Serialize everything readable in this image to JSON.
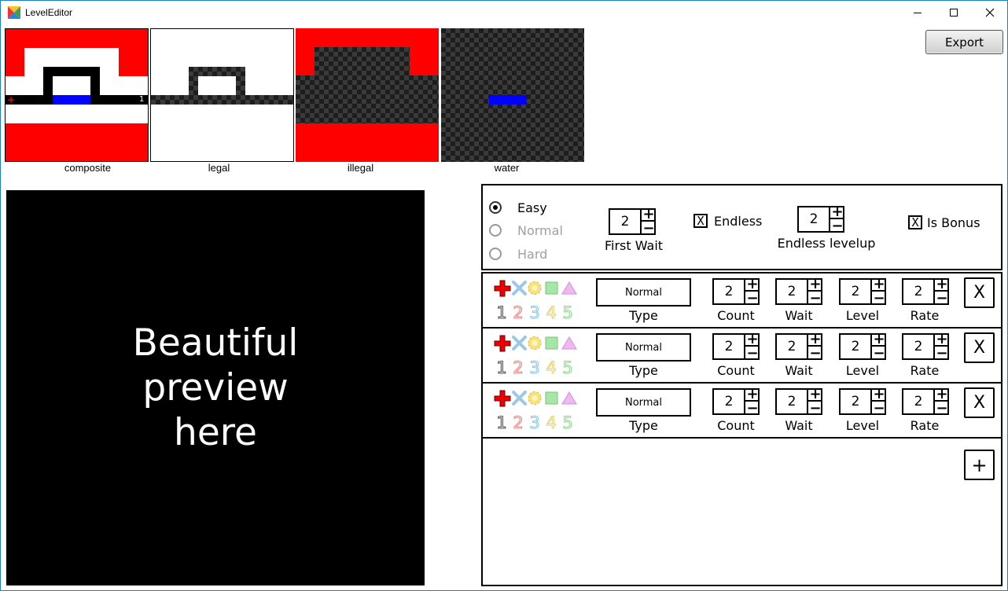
{
  "window": {
    "title": "LevelEditor"
  },
  "toolbar": {
    "export_label": "Export"
  },
  "layers": [
    {
      "label": "composite"
    },
    {
      "label": "legal"
    },
    {
      "label": "illegal"
    },
    {
      "label": "water"
    }
  ],
  "composite_marker": "1",
  "preview": {
    "text": "Beautiful\npreview\nhere"
  },
  "difficulty": {
    "options": [
      {
        "label": "Easy",
        "selected": true,
        "enabled": true
      },
      {
        "label": "Normal",
        "selected": false,
        "enabled": false
      },
      {
        "label": "Hard",
        "selected": false,
        "enabled": false
      }
    ]
  },
  "first_wait": {
    "value": "2",
    "label": "First Wait"
  },
  "endless": {
    "checked_glyph": "X",
    "label": "Endless"
  },
  "endless_levelup": {
    "value": "2",
    "label": "Endless levelup"
  },
  "is_bonus": {
    "checked_glyph": "X",
    "label": "Is Bonus"
  },
  "wave_labels": {
    "type": "Type",
    "count": "Count",
    "wait": "Wait",
    "level": "Level",
    "rate": "Rate"
  },
  "waves": [
    {
      "type": "Normal",
      "count": "2",
      "wait": "2",
      "level": "2",
      "rate": "2",
      "remove": "X"
    },
    {
      "type": "Normal",
      "count": "2",
      "wait": "2",
      "level": "2",
      "rate": "2",
      "remove": "X"
    },
    {
      "type": "Normal",
      "count": "2",
      "wait": "2",
      "level": "2",
      "rate": "2",
      "remove": "X"
    }
  ],
  "enemy_numbers": [
    "1",
    "2",
    "3",
    "4",
    "5"
  ],
  "enemy_icons": [
    "red-cross-icon",
    "blue-x-icon",
    "yellow-flower-icon",
    "green-square-icon",
    "pink-triangle-icon"
  ],
  "add_wave": {
    "label": "+"
  },
  "spinner_glyphs": {
    "up": "+",
    "down": "−"
  },
  "colors": {
    "red": "#ff0000",
    "blue": "#0000ff",
    "window_border": "#1b7fd1"
  }
}
